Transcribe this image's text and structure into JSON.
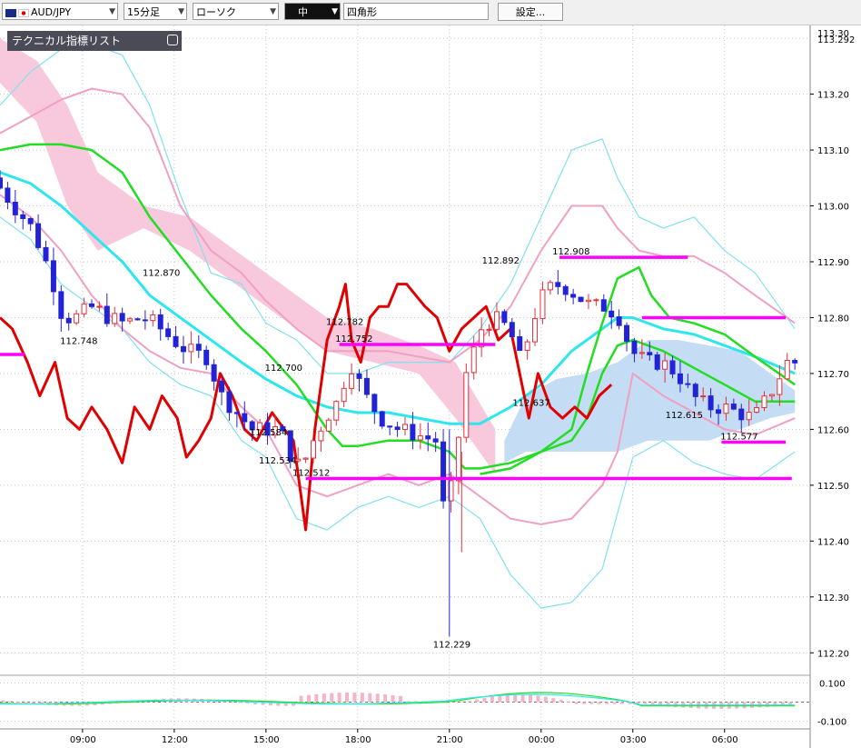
{
  "toolbar": {
    "symbol": "AUD/JPY",
    "timeframe": "15分足",
    "chart_type": "ローソク",
    "drawing_tool": "中",
    "shape": "四角形",
    "settings_label": "設定..."
  },
  "indicator_panel": {
    "title": "テクニカル指標リスト"
  },
  "colors": {
    "up_candle": "#e3303a",
    "down_candle": "#2323d6",
    "green_ma": "#22dd22",
    "cyan_ma": "#2ee6ee",
    "pink_band": "#f0a0c0",
    "cyan_band": "#80e0f0",
    "red_line": "#e00000",
    "magenta_level": "#ff00ff",
    "cloud_pink": "#f8c8dc",
    "cloud_blue": "#c4dcf4"
  },
  "chart_data": {
    "type": "candlestick",
    "price_axis_labels": [
      "113.30",
      "113.20",
      "113.10",
      "113.00",
      "112.90",
      "112.80",
      "112.70",
      "112.60",
      "112.50",
      "112.40",
      "112.30",
      "112.20"
    ],
    "price_top_labels": [
      "113.30",
      "113.292"
    ],
    "oscillator_axis_labels": [
      "0.100",
      "-0.100"
    ],
    "time_labels": [
      "09:00",
      "12:00",
      "15:00",
      "18:00",
      "21:00",
      "00:00",
      "03:00",
      "06:00"
    ],
    "ylim": [
      112.163,
      113.323
    ],
    "annotations": [
      {
        "text": "112.870",
        "price": 112.87,
        "time": 11.5
      },
      {
        "text": "112.748",
        "price": 112.748,
        "time": 8.8
      },
      {
        "text": "112.700",
        "price": 112.7,
        "time": 15.5
      },
      {
        "text": "112.584",
        "price": 112.584,
        "time": 15.0
      },
      {
        "text": "112.534",
        "price": 112.534,
        "time": 15.3
      },
      {
        "text": "112.512",
        "price": 112.512,
        "time": 16.4
      },
      {
        "text": "112.752",
        "price": 112.752,
        "time": 17.8
      },
      {
        "text": "112.782",
        "price": 112.782,
        "time": 17.5
      },
      {
        "text": "112.892",
        "price": 112.892,
        "time": 22.6
      },
      {
        "text": "112.229",
        "price": 112.229,
        "time": 21.0
      },
      {
        "text": "112.637",
        "price": 112.637,
        "time": 23.6
      },
      {
        "text": "112.908",
        "price": 112.908,
        "time": 24.9
      },
      {
        "text": "112.615",
        "price": 112.615,
        "time": 28.6
      },
      {
        "text": "112.577",
        "price": 112.577,
        "time": 30.4
      }
    ],
    "levels": [
      {
        "price": 112.734,
        "from": 6.0,
        "to": 7.1
      },
      {
        "price": 112.512,
        "from": 16.3,
        "to": 32.2
      },
      {
        "price": 112.752,
        "from": 17.4,
        "to": 22.5
      },
      {
        "price": 112.908,
        "from": 24.6,
        "to": 28.8
      },
      {
        "price": 112.8,
        "from": 27.3,
        "to": 32.0
      },
      {
        "price": 112.577,
        "from": 29.9,
        "to": 32.0
      }
    ]
  }
}
